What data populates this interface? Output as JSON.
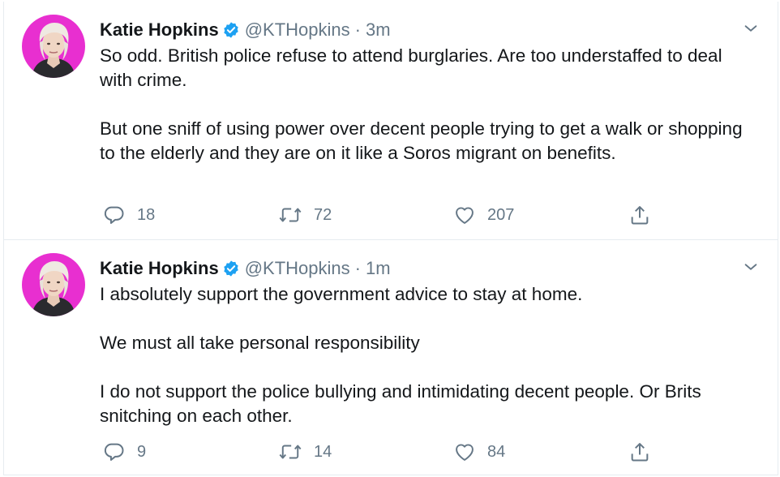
{
  "tweets": [
    {
      "name": "Katie Hopkins",
      "handle": "@KTHopkins",
      "separator": "·",
      "time": "3m",
      "paragraphs": [
        "So odd. British police refuse to attend burglaries. Are too understaffed to deal with crime.",
        "But one sniff of using power over decent people trying to get a walk or shopping to the elderly and they are on it like a Soros migrant on benefits."
      ],
      "replies": "18",
      "retweets": "72",
      "likes": "207"
    },
    {
      "name": "Katie Hopkins",
      "handle": "@KTHopkins",
      "separator": "·",
      "time": "1m",
      "paragraphs": [
        "I absolutely support the government advice to stay at home.",
        "We must all take personal responsibility",
        "I do not support the police bullying and intimidating decent people. Or Brits snitching on each other."
      ],
      "replies": "9",
      "retweets": "14",
      "likes": "84"
    }
  ],
  "colors": {
    "text": "#14171a",
    "muted": "#657786",
    "verified": "#1da1f2",
    "divider": "#e6ecf0",
    "avatar_bg": "#e82fd0"
  },
  "icons": [
    "verified-badge-icon",
    "chevron-down-icon",
    "reply-icon",
    "retweet-icon",
    "like-heart-icon",
    "share-icon"
  ]
}
